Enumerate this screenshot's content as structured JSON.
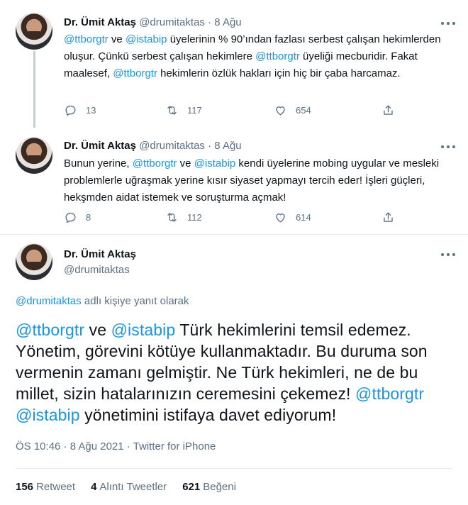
{
  "tweets": [
    {
      "name": "Dr. Ümit Aktaş",
      "handle": "@drumitaktas",
      "dot": "·",
      "date": "8 Ağu",
      "segments": [
        {
          "t": "@ttborgtr",
          "link": true
        },
        {
          "t": " ve ",
          "link": false
        },
        {
          "t": "@istabip",
          "link": true
        },
        {
          "t": " üyelerinin % 90’ından fazlası serbest çalışan hekimlerden oluşur. Çünkü serbest çalışan hekimlere ",
          "link": false
        },
        {
          "t": "@ttborgtr",
          "link": true
        },
        {
          "t": " üyeliği mecburidir. Fakat maalesef, ",
          "link": false
        },
        {
          "t": "@ttborgtr",
          "link": true
        },
        {
          "t": " hekimlerin özlük hakları için hiç bir çaba harcamaz.",
          "link": false
        }
      ],
      "replies": "13",
      "retweets": "117",
      "likes": "654"
    },
    {
      "name": "Dr. Ümit Aktaş",
      "handle": "@drumitaktas",
      "dot": "·",
      "date": "8 Ağu",
      "segments": [
        {
          "t": "Bunun yerine, ",
          "link": false
        },
        {
          "t": "@ttborgtr",
          "link": true
        },
        {
          "t": " ve ",
          "link": false
        },
        {
          "t": "@istabip",
          "link": true
        },
        {
          "t": " kendi üyelerine mobing uygular ve mesleki problemlerle uğraşmak yerine kısır siyaset yapmayı tercih eder! İşleri güçleri, hekşmden aidat istemek ve soruşturma açmak!",
          "link": false
        }
      ],
      "replies": "8",
      "retweets": "112",
      "likes": "614"
    }
  ],
  "main": {
    "name": "Dr. Ümit Aktaş",
    "handle": "@drumitaktas",
    "reply_segments": [
      {
        "t": "@drumitaktas",
        "link": true
      },
      {
        "t": " adlı kişiye yanıt olarak",
        "link": false
      }
    ],
    "segments": [
      {
        "t": "@ttborgtr",
        "link": true
      },
      {
        "t": " ve ",
        "link": false
      },
      {
        "t": "@istabip",
        "link": true
      },
      {
        "t": " Türk hekimlerini temsil edemez. Yönetim, görevini kötüye kullanmaktadır. Bu duruma son vermenin zamanı gelmiştir. Ne Türk hekimleri, ne de bu millet, sizin hatalarınızın ceremesini çekemez! ",
        "link": false
      },
      {
        "t": "@ttborgtr",
        "link": true
      },
      {
        "t": " ",
        "link": false
      },
      {
        "t": "@istabip",
        "link": true
      },
      {
        "t": " yönetimini istifaya davet ediyorum!",
        "link": false
      }
    ],
    "meta": "ÖS 10:46 · 8 Ağu 2021 · Twitter for iPhone",
    "stats": {
      "retweets_count": "156",
      "retweets_label": "Retweet",
      "quotes_count": "4",
      "quotes_label": "Alıntı Tweetler",
      "likes_count": "621",
      "likes_label": "Beğeni"
    }
  },
  "icons": [
    "reply-icon",
    "retweet-icon",
    "like-icon",
    "share-icon",
    "more-icon"
  ],
  "colors": {
    "link": "#1b95e0",
    "muted": "#5b7083",
    "text": "#0f1419",
    "divider": "#e6ecf0"
  }
}
